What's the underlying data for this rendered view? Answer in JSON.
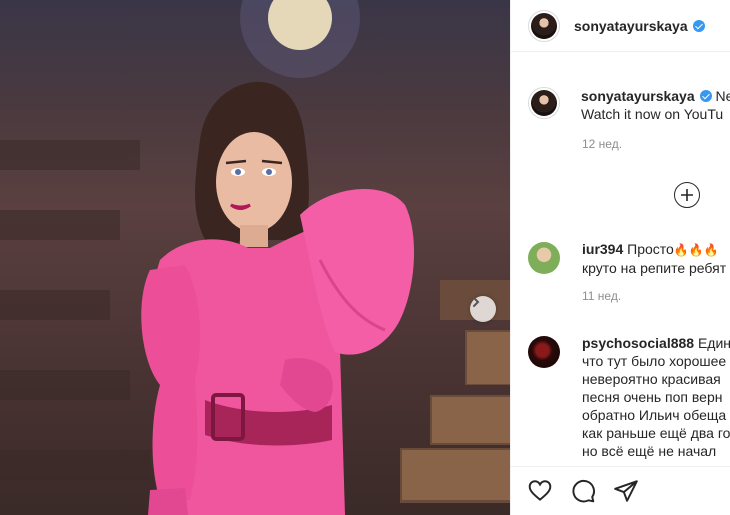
{
  "post": {
    "author": {
      "username": "sonyatayurskaya",
      "verified": true
    },
    "caption": {
      "line1": "Ne",
      "line2": "Watch it now on YouTu",
      "time": "12 нед."
    },
    "media": {
      "next_icon": "chevron-right-icon"
    }
  },
  "load_more_icon": "plus-circle-icon",
  "comments": [
    {
      "username": "iur394",
      "line1": "Просто",
      "emoji": "🔥🔥🔥",
      "line2": "круто на репите ребят",
      "time": "11 нед."
    },
    {
      "username": "psychosocial888",
      "line1": "Едине",
      "lines": [
        "что тут было хорошее",
        "невероятно красивая",
        "песня очень поп верн",
        "обратно Ильич обеща",
        "как раньше ещё два го",
        "но всё ещё не начал"
      ]
    }
  ],
  "actions": {
    "like_icon": "heart-icon",
    "comment_icon": "comment-icon",
    "share_icon": "paper-plane-icon"
  },
  "colors": {
    "dress": "#f0569e",
    "belt": "#a8255a",
    "verified": "#3897f0",
    "time": "#8e8e8e"
  }
}
